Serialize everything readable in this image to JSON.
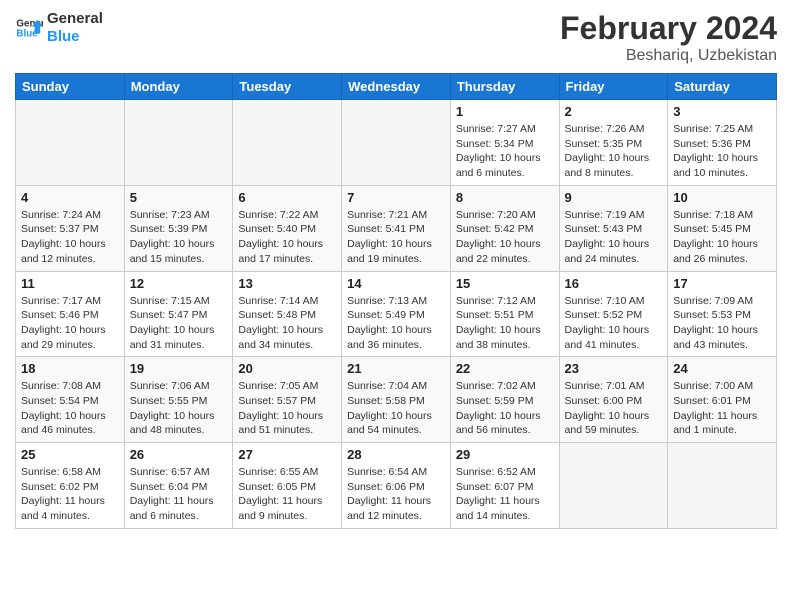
{
  "header": {
    "logo_text_general": "General",
    "logo_text_blue": "Blue",
    "title": "February 2024",
    "subtitle": "Beshariq, Uzbekistan"
  },
  "days_of_week": [
    "Sunday",
    "Monday",
    "Tuesday",
    "Wednesday",
    "Thursday",
    "Friday",
    "Saturday"
  ],
  "weeks": [
    [
      {
        "day": "",
        "info": "",
        "empty": true
      },
      {
        "day": "",
        "info": "",
        "empty": true
      },
      {
        "day": "",
        "info": "",
        "empty": true
      },
      {
        "day": "",
        "info": "",
        "empty": true
      },
      {
        "day": "1",
        "info": "Sunrise: 7:27 AM\nSunset: 5:34 PM\nDaylight: 10 hours\nand 6 minutes.",
        "empty": false
      },
      {
        "day": "2",
        "info": "Sunrise: 7:26 AM\nSunset: 5:35 PM\nDaylight: 10 hours\nand 8 minutes.",
        "empty": false
      },
      {
        "day": "3",
        "info": "Sunrise: 7:25 AM\nSunset: 5:36 PM\nDaylight: 10 hours\nand 10 minutes.",
        "empty": false
      }
    ],
    [
      {
        "day": "4",
        "info": "Sunrise: 7:24 AM\nSunset: 5:37 PM\nDaylight: 10 hours\nand 12 minutes.",
        "empty": false
      },
      {
        "day": "5",
        "info": "Sunrise: 7:23 AM\nSunset: 5:39 PM\nDaylight: 10 hours\nand 15 minutes.",
        "empty": false
      },
      {
        "day": "6",
        "info": "Sunrise: 7:22 AM\nSunset: 5:40 PM\nDaylight: 10 hours\nand 17 minutes.",
        "empty": false
      },
      {
        "day": "7",
        "info": "Sunrise: 7:21 AM\nSunset: 5:41 PM\nDaylight: 10 hours\nand 19 minutes.",
        "empty": false
      },
      {
        "day": "8",
        "info": "Sunrise: 7:20 AM\nSunset: 5:42 PM\nDaylight: 10 hours\nand 22 minutes.",
        "empty": false
      },
      {
        "day": "9",
        "info": "Sunrise: 7:19 AM\nSunset: 5:43 PM\nDaylight: 10 hours\nand 24 minutes.",
        "empty": false
      },
      {
        "day": "10",
        "info": "Sunrise: 7:18 AM\nSunset: 5:45 PM\nDaylight: 10 hours\nand 26 minutes.",
        "empty": false
      }
    ],
    [
      {
        "day": "11",
        "info": "Sunrise: 7:17 AM\nSunset: 5:46 PM\nDaylight: 10 hours\nand 29 minutes.",
        "empty": false
      },
      {
        "day": "12",
        "info": "Sunrise: 7:15 AM\nSunset: 5:47 PM\nDaylight: 10 hours\nand 31 minutes.",
        "empty": false
      },
      {
        "day": "13",
        "info": "Sunrise: 7:14 AM\nSunset: 5:48 PM\nDaylight: 10 hours\nand 34 minutes.",
        "empty": false
      },
      {
        "day": "14",
        "info": "Sunrise: 7:13 AM\nSunset: 5:49 PM\nDaylight: 10 hours\nand 36 minutes.",
        "empty": false
      },
      {
        "day": "15",
        "info": "Sunrise: 7:12 AM\nSunset: 5:51 PM\nDaylight: 10 hours\nand 38 minutes.",
        "empty": false
      },
      {
        "day": "16",
        "info": "Sunrise: 7:10 AM\nSunset: 5:52 PM\nDaylight: 10 hours\nand 41 minutes.",
        "empty": false
      },
      {
        "day": "17",
        "info": "Sunrise: 7:09 AM\nSunset: 5:53 PM\nDaylight: 10 hours\nand 43 minutes.",
        "empty": false
      }
    ],
    [
      {
        "day": "18",
        "info": "Sunrise: 7:08 AM\nSunset: 5:54 PM\nDaylight: 10 hours\nand 46 minutes.",
        "empty": false
      },
      {
        "day": "19",
        "info": "Sunrise: 7:06 AM\nSunset: 5:55 PM\nDaylight: 10 hours\nand 48 minutes.",
        "empty": false
      },
      {
        "day": "20",
        "info": "Sunrise: 7:05 AM\nSunset: 5:57 PM\nDaylight: 10 hours\nand 51 minutes.",
        "empty": false
      },
      {
        "day": "21",
        "info": "Sunrise: 7:04 AM\nSunset: 5:58 PM\nDaylight: 10 hours\nand 54 minutes.",
        "empty": false
      },
      {
        "day": "22",
        "info": "Sunrise: 7:02 AM\nSunset: 5:59 PM\nDaylight: 10 hours\nand 56 minutes.",
        "empty": false
      },
      {
        "day": "23",
        "info": "Sunrise: 7:01 AM\nSunset: 6:00 PM\nDaylight: 10 hours\nand 59 minutes.",
        "empty": false
      },
      {
        "day": "24",
        "info": "Sunrise: 7:00 AM\nSunset: 6:01 PM\nDaylight: 11 hours\nand 1 minute.",
        "empty": false
      }
    ],
    [
      {
        "day": "25",
        "info": "Sunrise: 6:58 AM\nSunset: 6:02 PM\nDaylight: 11 hours\nand 4 minutes.",
        "empty": false
      },
      {
        "day": "26",
        "info": "Sunrise: 6:57 AM\nSunset: 6:04 PM\nDaylight: 11 hours\nand 6 minutes.",
        "empty": false
      },
      {
        "day": "27",
        "info": "Sunrise: 6:55 AM\nSunset: 6:05 PM\nDaylight: 11 hours\nand 9 minutes.",
        "empty": false
      },
      {
        "day": "28",
        "info": "Sunrise: 6:54 AM\nSunset: 6:06 PM\nDaylight: 11 hours\nand 12 minutes.",
        "empty": false
      },
      {
        "day": "29",
        "info": "Sunrise: 6:52 AM\nSunset: 6:07 PM\nDaylight: 11 hours\nand 14 minutes.",
        "empty": false
      },
      {
        "day": "",
        "info": "",
        "empty": true
      },
      {
        "day": "",
        "info": "",
        "empty": true
      }
    ]
  ]
}
